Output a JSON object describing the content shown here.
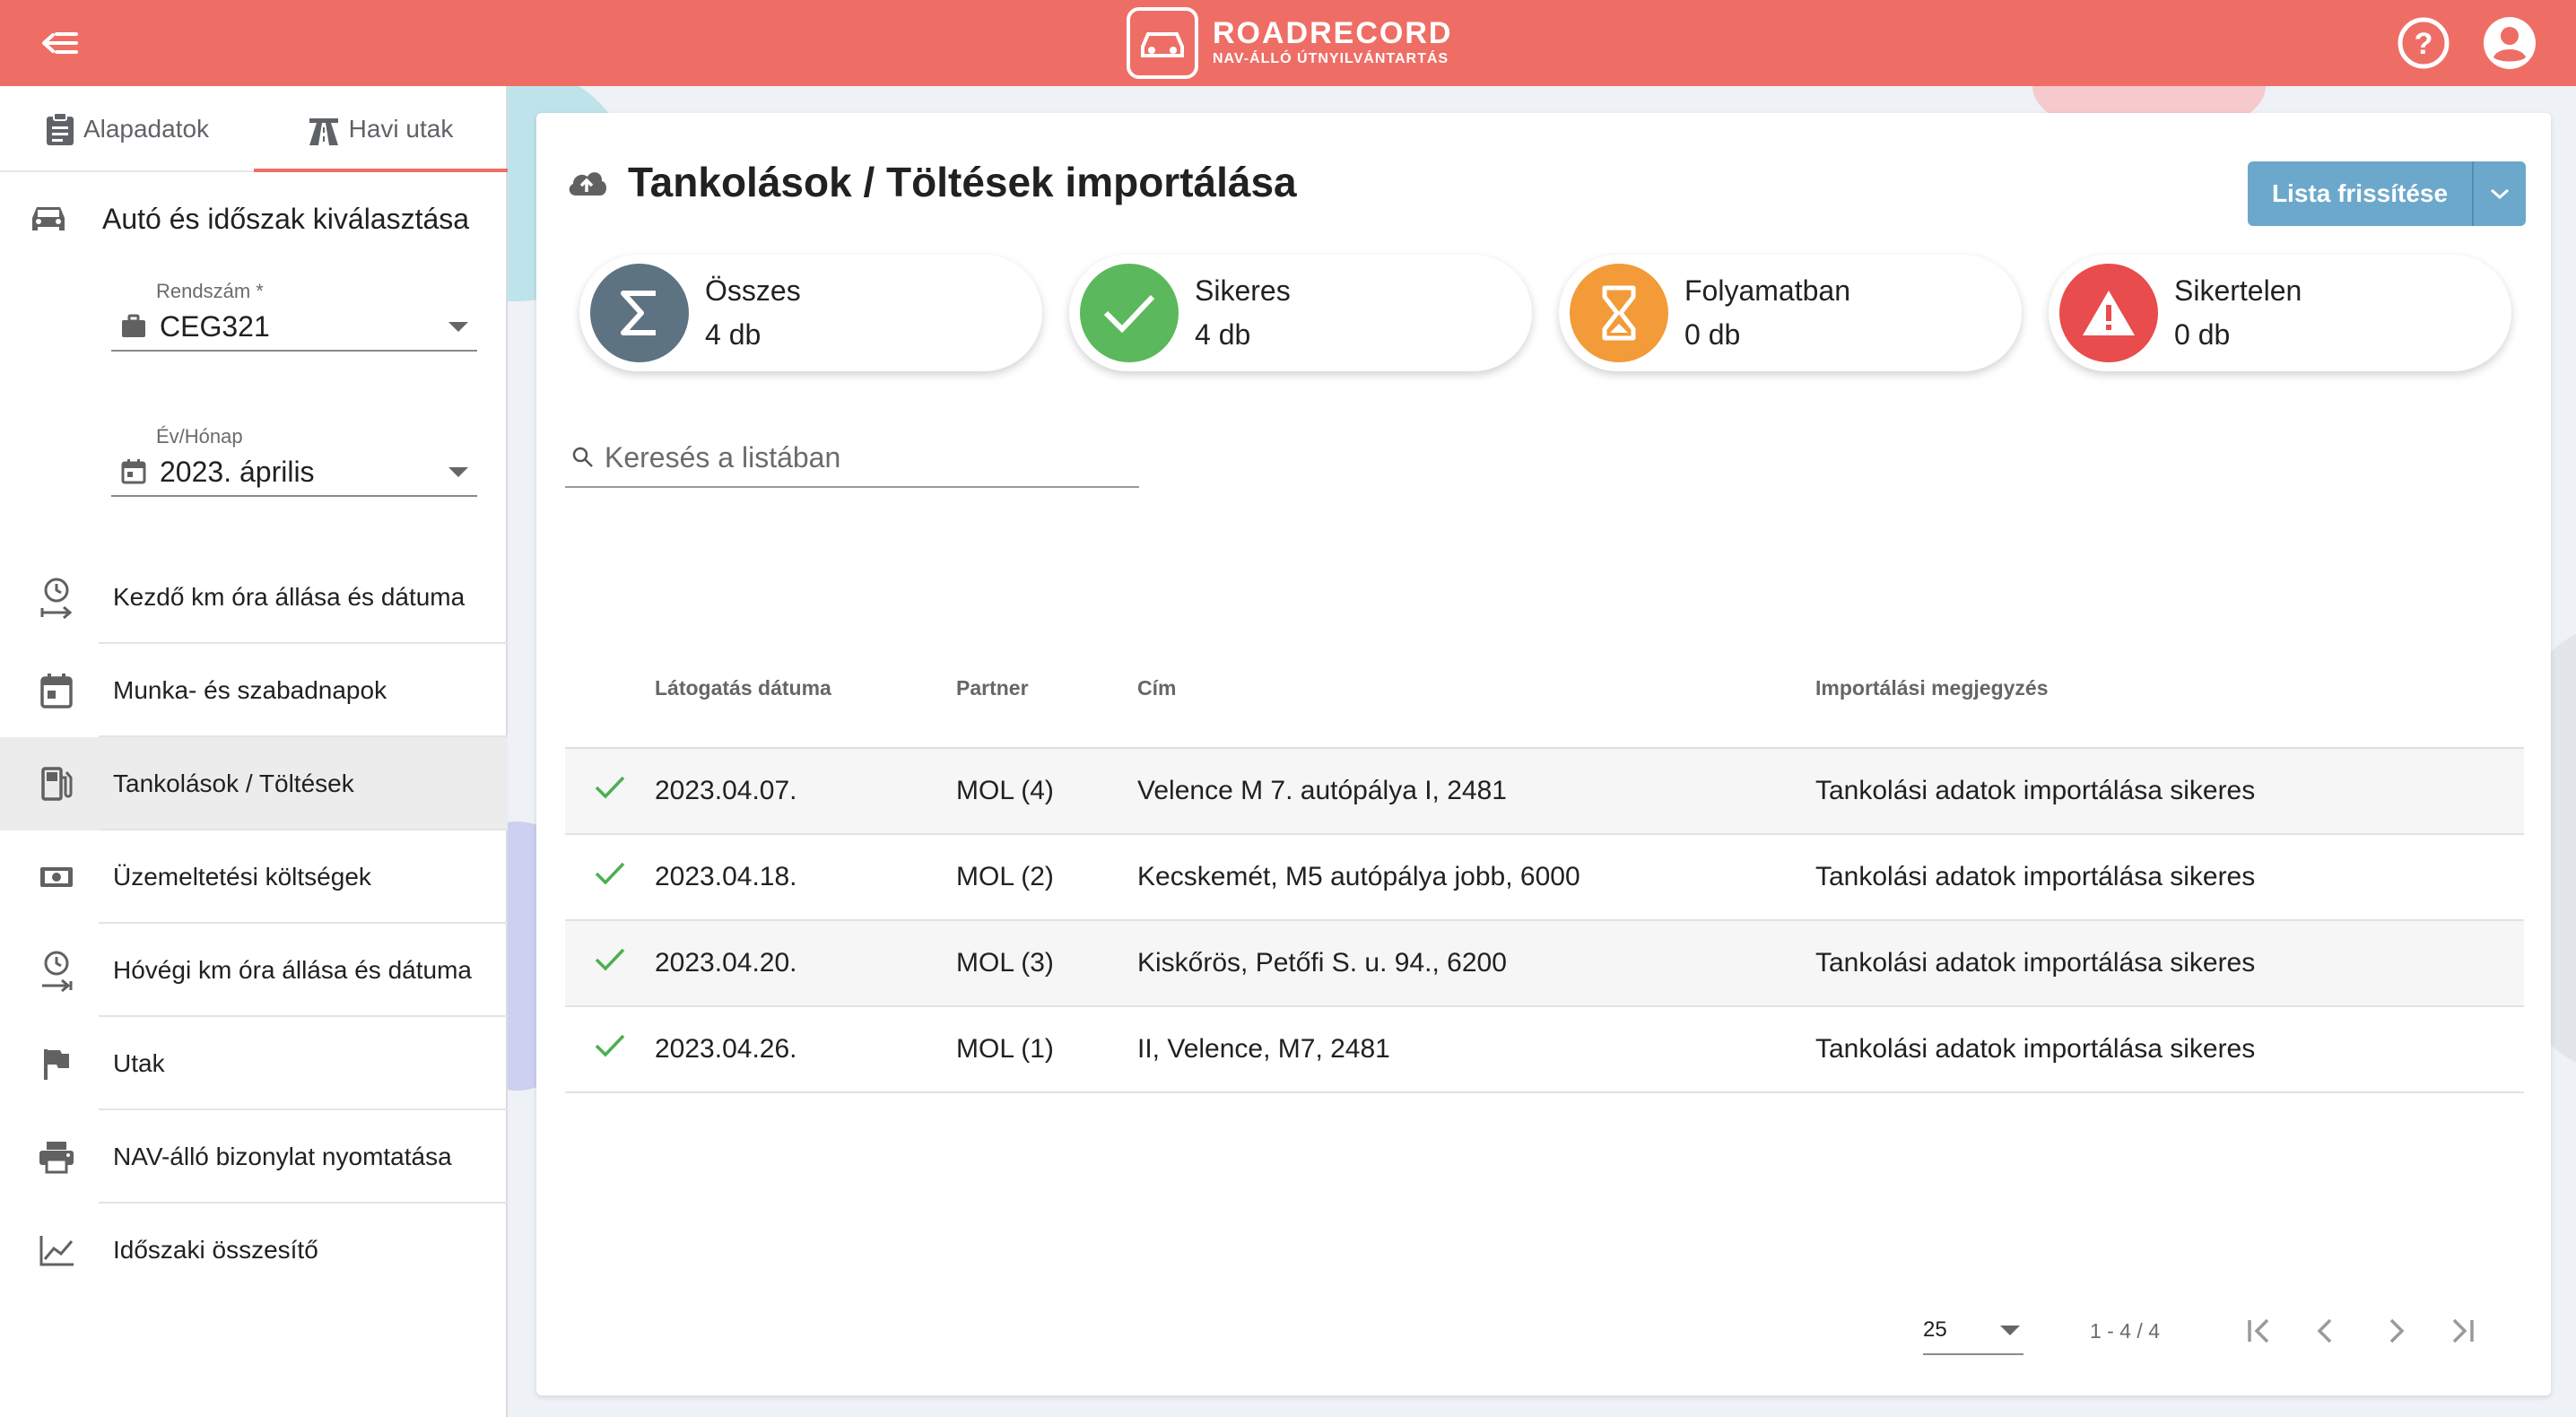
{
  "app": {
    "brand_name": "ROADRECORD",
    "brand_subtitle": "NAV-ÁLLÓ ÚTNYILVÁNTARTÁS",
    "accent_color": "#ee6e66"
  },
  "sidebar": {
    "tabs": [
      {
        "label": "Alapadatok",
        "icon": "clipboard-icon"
      },
      {
        "label": "Havi utak",
        "icon": "road-icon"
      }
    ],
    "active_tab": "Havi utak",
    "section_title": "Autó és időszak kiválasztása",
    "plate_field": {
      "label": "Rendszám *",
      "value": "CEG321"
    },
    "period_field": {
      "label": "Év/Hónap",
      "value": "2023. április"
    },
    "items": [
      {
        "label": "Kezdő km óra állása és dátuma",
        "icon": "clock-arrow-icon"
      },
      {
        "label": "Munka- és szabadnapok",
        "icon": "calendar-icon"
      },
      {
        "label": "Tankolások / Töltések",
        "icon": "fuel-icon"
      },
      {
        "label": "Üzemeltetési költségek",
        "icon": "money-icon"
      },
      {
        "label": "Hóvégi km óra állása és dátuma",
        "icon": "clock-arrow-end-icon"
      },
      {
        "label": "Utak",
        "icon": "flag-icon"
      },
      {
        "label": "NAV-álló bizonylat nyomtatása",
        "icon": "printer-icon"
      },
      {
        "label": "Időszaki összesítő",
        "icon": "chart-icon"
      }
    ],
    "active_item": "Tankolások / Töltések"
  },
  "main": {
    "title": "Tankolások / Töltések importálása",
    "refresh_label": "Lista frissítése",
    "stats": [
      {
        "label": "Összes",
        "value": "4 db",
        "icon": "sigma-icon",
        "color": "#5e7382"
      },
      {
        "label": "Sikeres",
        "value": "4 db",
        "icon": "check-icon",
        "color": "#5cb85c"
      },
      {
        "label": "Folyamatban",
        "value": "0 db",
        "icon": "hourglass-icon",
        "color": "#f29b38"
      },
      {
        "label": "Sikertelen",
        "value": "0 db",
        "icon": "warning-icon",
        "color": "#e84c4c"
      }
    ],
    "search_placeholder": "Keresés a listában",
    "table": {
      "headers": [
        "Látogatás dátuma",
        "Partner",
        "Cím",
        "Importálási megjegyzés"
      ],
      "rows": [
        {
          "date": "2023.04.07.",
          "partner": "MOL (4)",
          "address": "Velence M 7. autópálya I, 2481",
          "note": "Tankolási adatok importálása sikeres"
        },
        {
          "date": "2023.04.18.",
          "partner": "MOL (2)",
          "address": "Kecskemét, M5 autópálya jobb, 6000",
          "note": "Tankolási adatok importálása sikeres"
        },
        {
          "date": "2023.04.20.",
          "partner": "MOL (3)",
          "address": "Kiskőrös, Petőfi S. u. 94., 6200",
          "note": "Tankolási adatok importálása sikeres"
        },
        {
          "date": "2023.04.26.",
          "partner": "MOL (1)",
          "address": "II, Velence, M7, 2481",
          "note": "Tankolási adatok importálása sikeres"
        }
      ]
    },
    "pagination": {
      "page_size": "25",
      "range": "1 - 4 / 4"
    }
  }
}
